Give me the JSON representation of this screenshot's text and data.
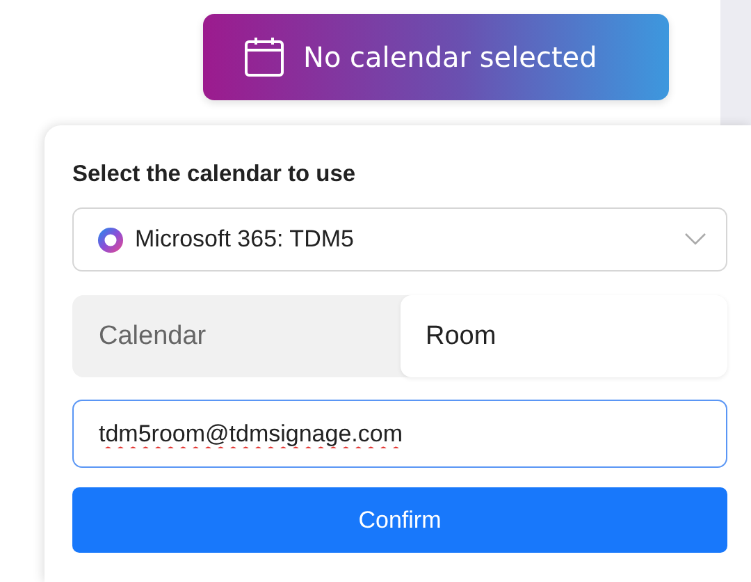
{
  "calendar_button": {
    "label": "No calendar selected"
  },
  "popup": {
    "heading": "Select the calendar to use",
    "account_select": {
      "value": "Microsoft 365: TDM5"
    },
    "type_options": [
      {
        "label": "Calendar",
        "selected": false
      },
      {
        "label": "Room",
        "selected": true
      }
    ],
    "email_field": {
      "value": "tdm5room@tdmsignage.com",
      "spelling_flagged": true
    },
    "confirm_button": {
      "label": "Confirm"
    }
  }
}
